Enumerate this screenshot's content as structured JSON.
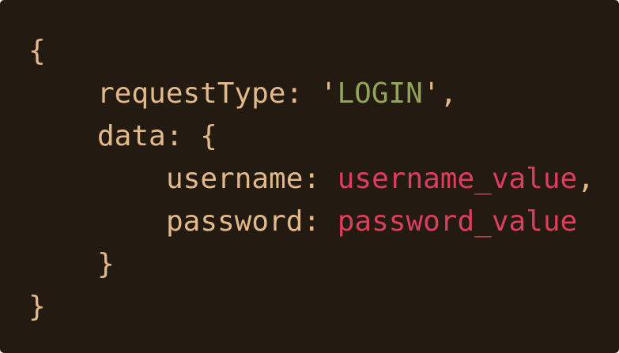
{
  "code": {
    "lines": [
      {
        "brace": "{"
      },
      {
        "key": "requestType",
        "colon": ": ",
        "quote_open": "'",
        "string_value": "LOGIN",
        "quote_close": "'",
        "comma": ","
      },
      {
        "key": "data",
        "colon": ": ",
        "brace": "{"
      },
      {
        "key": "username",
        "colon": ": ",
        "value": "username_value",
        "comma": ","
      },
      {
        "key": "password",
        "colon": ": ",
        "value": "password_value"
      },
      {
        "brace": "}"
      },
      {
        "brace": "}"
      }
    ]
  },
  "colors": {
    "background": "#231a12",
    "text": "#e3b98a",
    "string": "#91a457",
    "variable": "#df3d5c"
  }
}
